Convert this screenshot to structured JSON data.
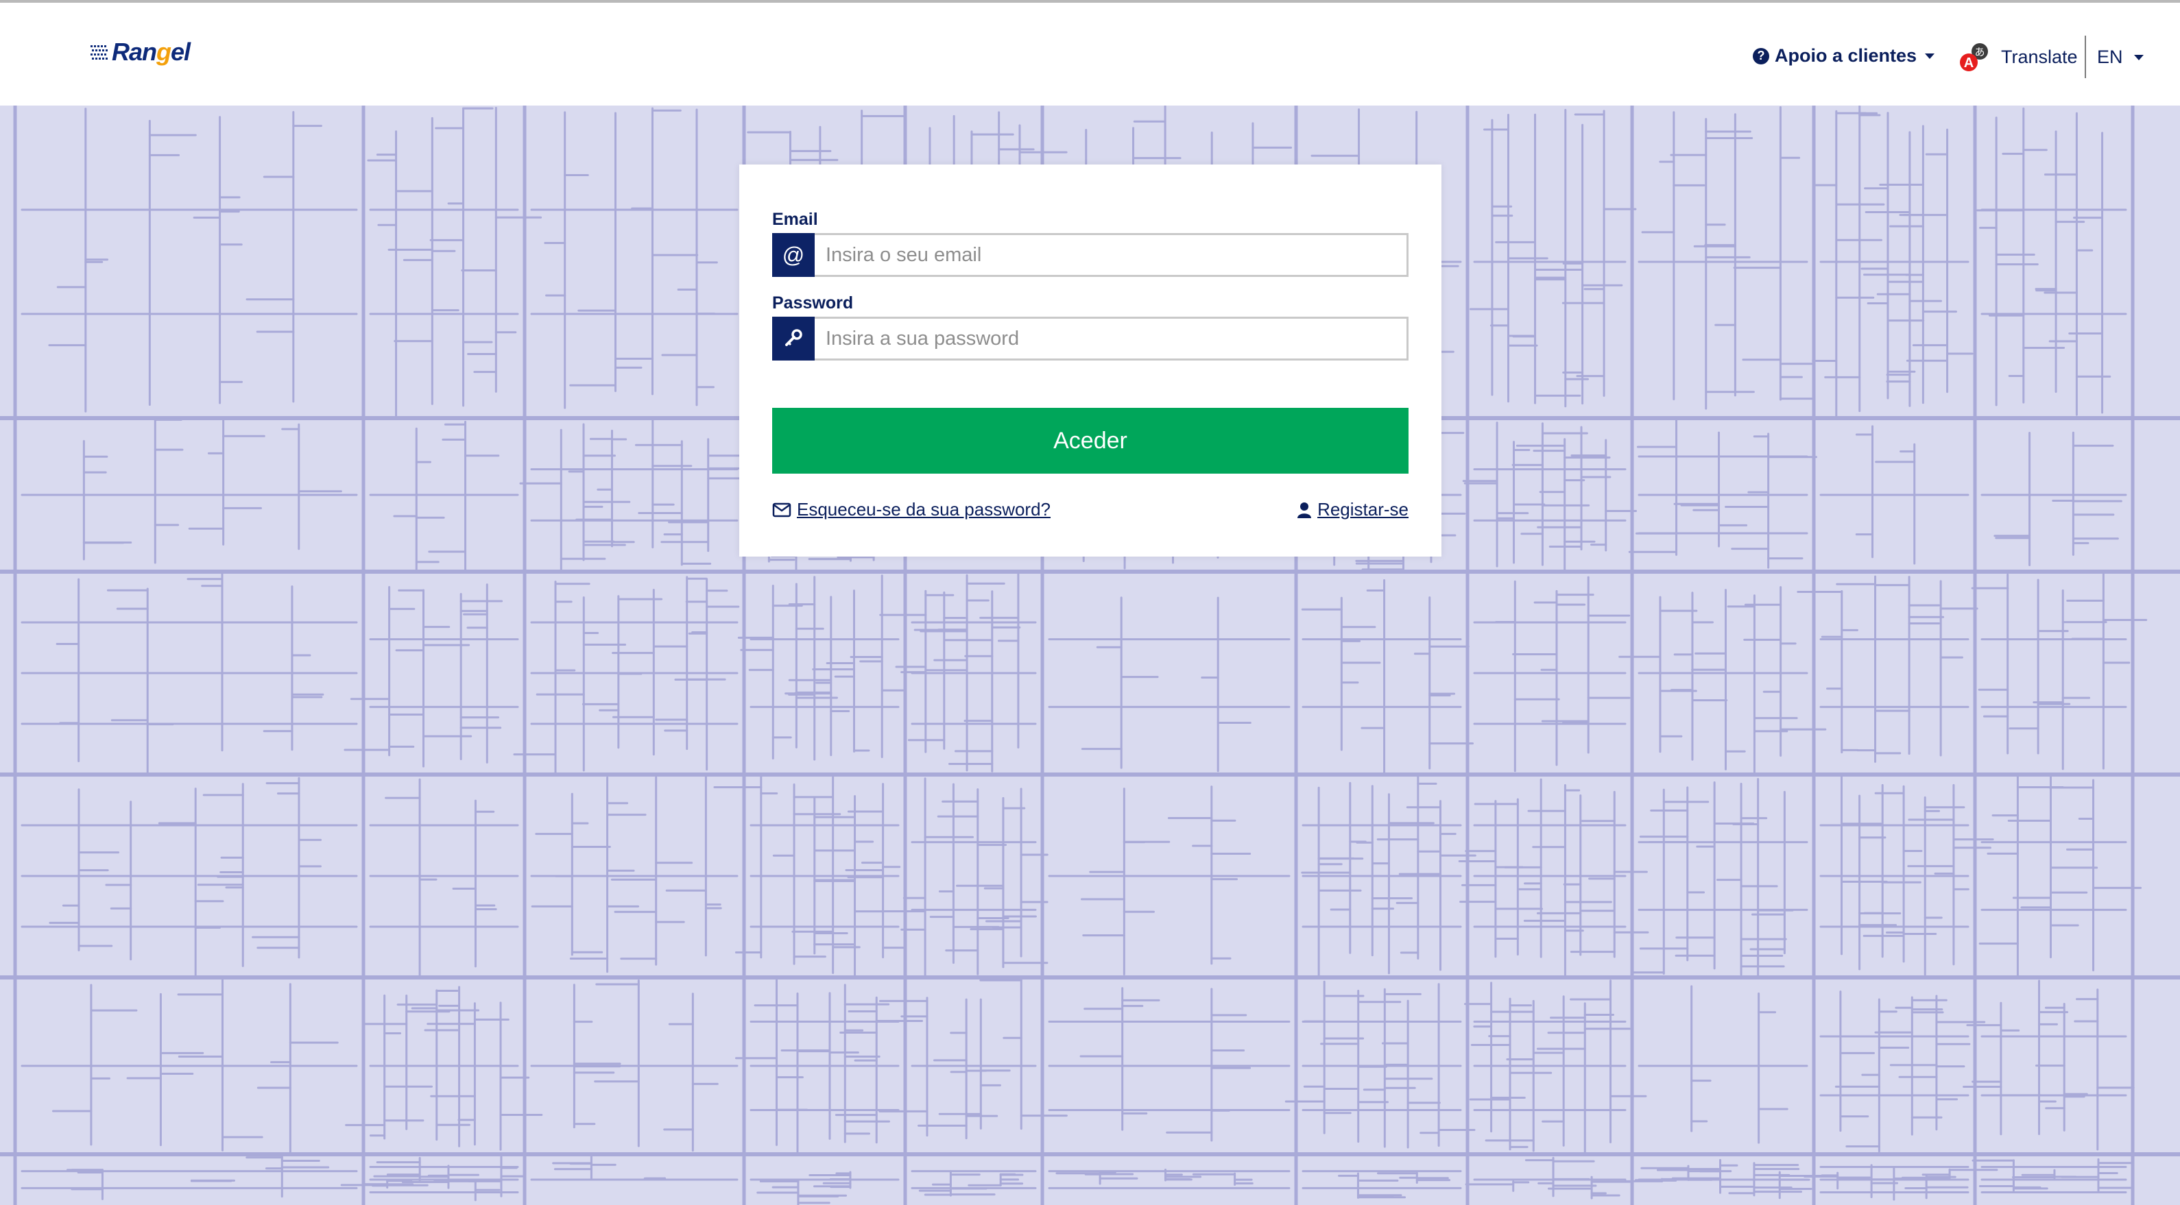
{
  "header": {
    "logo": {
      "text_main": "Ran",
      "text_accent": "g",
      "text_end": "el"
    },
    "support": {
      "label": "Apoio a clientes",
      "icon": "question-circle-icon"
    },
    "translate": {
      "label": "Translate",
      "icon": "google-translate-icon"
    },
    "language": {
      "label": "EN"
    }
  },
  "login": {
    "email": {
      "label": "Email",
      "placeholder": "Insira o seu email",
      "value": "",
      "icon": "at-icon",
      "icon_glyph": "@"
    },
    "password": {
      "label": "Password",
      "placeholder": "Insira a sua password",
      "value": "",
      "icon": "key-icon"
    },
    "submit_label": "Aceder",
    "forgot_label": "Esqueceu-se da sua password?",
    "register_label": "Registar-se"
  },
  "colors": {
    "brand_navy": "#0d2366",
    "brand_accent": "#f3a00b",
    "submit_green": "#00a65a",
    "map_background": "#d9daef",
    "map_roads": "#a9aad8"
  }
}
